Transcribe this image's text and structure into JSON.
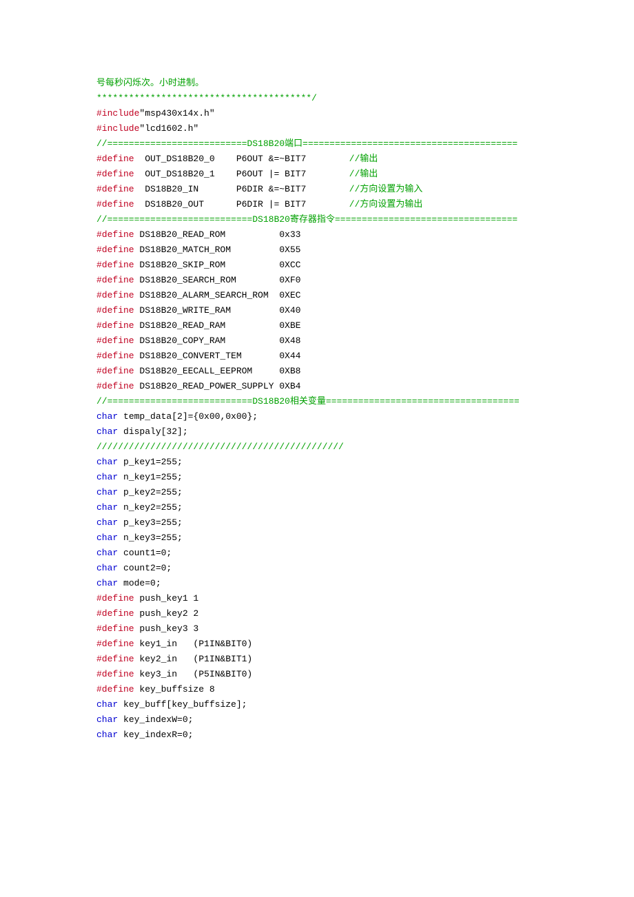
{
  "lines": [
    [
      [
        "green",
        "号每秒闪烁次。小时进制。"
      ]
    ],
    [
      [
        "green",
        "****************************************/"
      ]
    ],
    [
      [
        "red",
        "#include"
      ],
      [
        "black",
        "\"msp430x14x.h\""
      ]
    ],
    [
      [
        "red",
        "#include"
      ],
      [
        "black",
        "\"lcd1602.h\""
      ]
    ],
    [
      [
        "green",
        "//==========================DS18B20端口========================================"
      ]
    ],
    [
      [
        "red",
        "#define"
      ],
      [
        "black",
        "  OUT_DS18B20_0    P6OUT &=~BIT7        "
      ],
      [
        "green",
        "//输出"
      ]
    ],
    [
      [
        "red",
        "#define"
      ],
      [
        "black",
        "  OUT_DS18B20_1    P6OUT |= BIT7        "
      ],
      [
        "green",
        "//输出"
      ]
    ],
    [
      [
        "red",
        "#define"
      ],
      [
        "black",
        "  DS18B20_IN       P6DIR &=~BIT7        "
      ],
      [
        "green",
        "//方向设置为输入"
      ]
    ],
    [
      [
        "red",
        "#define"
      ],
      [
        "black",
        "  DS18B20_OUT      P6DIR |= BIT7        "
      ],
      [
        "green",
        "//方向设置为输出"
      ]
    ],
    [
      [
        "green",
        "//===========================DS18B20寄存器指令=================================="
      ]
    ],
    [
      [
        "red",
        "#define"
      ],
      [
        "black",
        " DS18B20_READ_ROM          0x33"
      ]
    ],
    [
      [
        "red",
        "#define"
      ],
      [
        "black",
        " DS18B20_MATCH_ROM         0X55"
      ]
    ],
    [
      [
        "red",
        "#define"
      ],
      [
        "black",
        " DS18B20_SKIP_ROM          0XCC"
      ]
    ],
    [
      [
        "red",
        "#define"
      ],
      [
        "black",
        " DS18B20_SEARCH_ROM        0XF0"
      ]
    ],
    [
      [
        "red",
        "#define"
      ],
      [
        "black",
        " DS18B20_ALARM_SEARCH_ROM  0XEC"
      ]
    ],
    [
      [
        "red",
        "#define"
      ],
      [
        "black",
        " DS18B20_WRITE_RAM         0X40"
      ]
    ],
    [
      [
        "red",
        "#define"
      ],
      [
        "black",
        " DS18B20_READ_RAM          0XBE"
      ]
    ],
    [
      [
        "red",
        "#define"
      ],
      [
        "black",
        " DS18B20_COPY_RAM          0X48"
      ]
    ],
    [
      [
        "red",
        "#define"
      ],
      [
        "black",
        " DS18B20_CONVERT_TEM       0X44"
      ]
    ],
    [
      [
        "red",
        "#define"
      ],
      [
        "black",
        " DS18B20_EECALL_EEPROM     0XB8"
      ]
    ],
    [
      [
        "red",
        "#define"
      ],
      [
        "black",
        " DS18B20_READ_POWER_SUPPLY 0XB4"
      ]
    ],
    [
      [
        "green",
        "//===========================DS18B20相关变量===================================="
      ]
    ],
    [
      [
        "blue",
        "char"
      ],
      [
        "black",
        " temp_data[2]={0x00,0x00};"
      ]
    ],
    [
      [
        "blue",
        "char"
      ],
      [
        "black",
        " dispaly[32];"
      ]
    ],
    [
      [
        "green",
        "//////////////////////////////////////////////"
      ]
    ],
    [
      [
        "blue",
        "char"
      ],
      [
        "black",
        " p_key1=255;"
      ]
    ],
    [
      [
        "blue",
        "char"
      ],
      [
        "black",
        " n_key1=255;"
      ]
    ],
    [
      [
        "blue",
        "char"
      ],
      [
        "black",
        " p_key2=255;"
      ]
    ],
    [
      [
        "blue",
        "char"
      ],
      [
        "black",
        " n_key2=255;"
      ]
    ],
    [
      [
        "blue",
        "char"
      ],
      [
        "black",
        " p_key3=255;"
      ]
    ],
    [
      [
        "blue",
        "char"
      ],
      [
        "black",
        " n_key3=255;"
      ]
    ],
    [
      [
        "blue",
        "char"
      ],
      [
        "black",
        " count1=0;"
      ]
    ],
    [
      [
        "blue",
        "char"
      ],
      [
        "black",
        " count2=0;"
      ]
    ],
    [
      [
        "blue",
        "char"
      ],
      [
        "black",
        " mode=0;"
      ]
    ],
    [
      [
        "red",
        "#define"
      ],
      [
        "black",
        " push_key1 1"
      ]
    ],
    [
      [
        "red",
        "#define"
      ],
      [
        "black",
        " push_key2 2"
      ]
    ],
    [
      [
        "red",
        "#define"
      ],
      [
        "black",
        " push_key3 3"
      ]
    ],
    [
      [
        "red",
        "#define"
      ],
      [
        "black",
        " key1_in   (P1IN&BIT0)"
      ]
    ],
    [
      [
        "red",
        "#define"
      ],
      [
        "black",
        " key2_in   (P1IN&BIT1)"
      ]
    ],
    [
      [
        "red",
        "#define"
      ],
      [
        "black",
        " key3_in   (P5IN&BIT0)"
      ]
    ],
    [
      [
        "red",
        "#define"
      ],
      [
        "black",
        " key_buffsize 8"
      ]
    ],
    [
      [
        "blue",
        "char"
      ],
      [
        "black",
        " key_buff[key_buffsize];"
      ]
    ],
    [
      [
        "blue",
        "char"
      ],
      [
        "black",
        " key_indexW=0;"
      ]
    ],
    [
      [
        "blue",
        "char"
      ],
      [
        "black",
        " key_indexR=0;"
      ]
    ]
  ]
}
